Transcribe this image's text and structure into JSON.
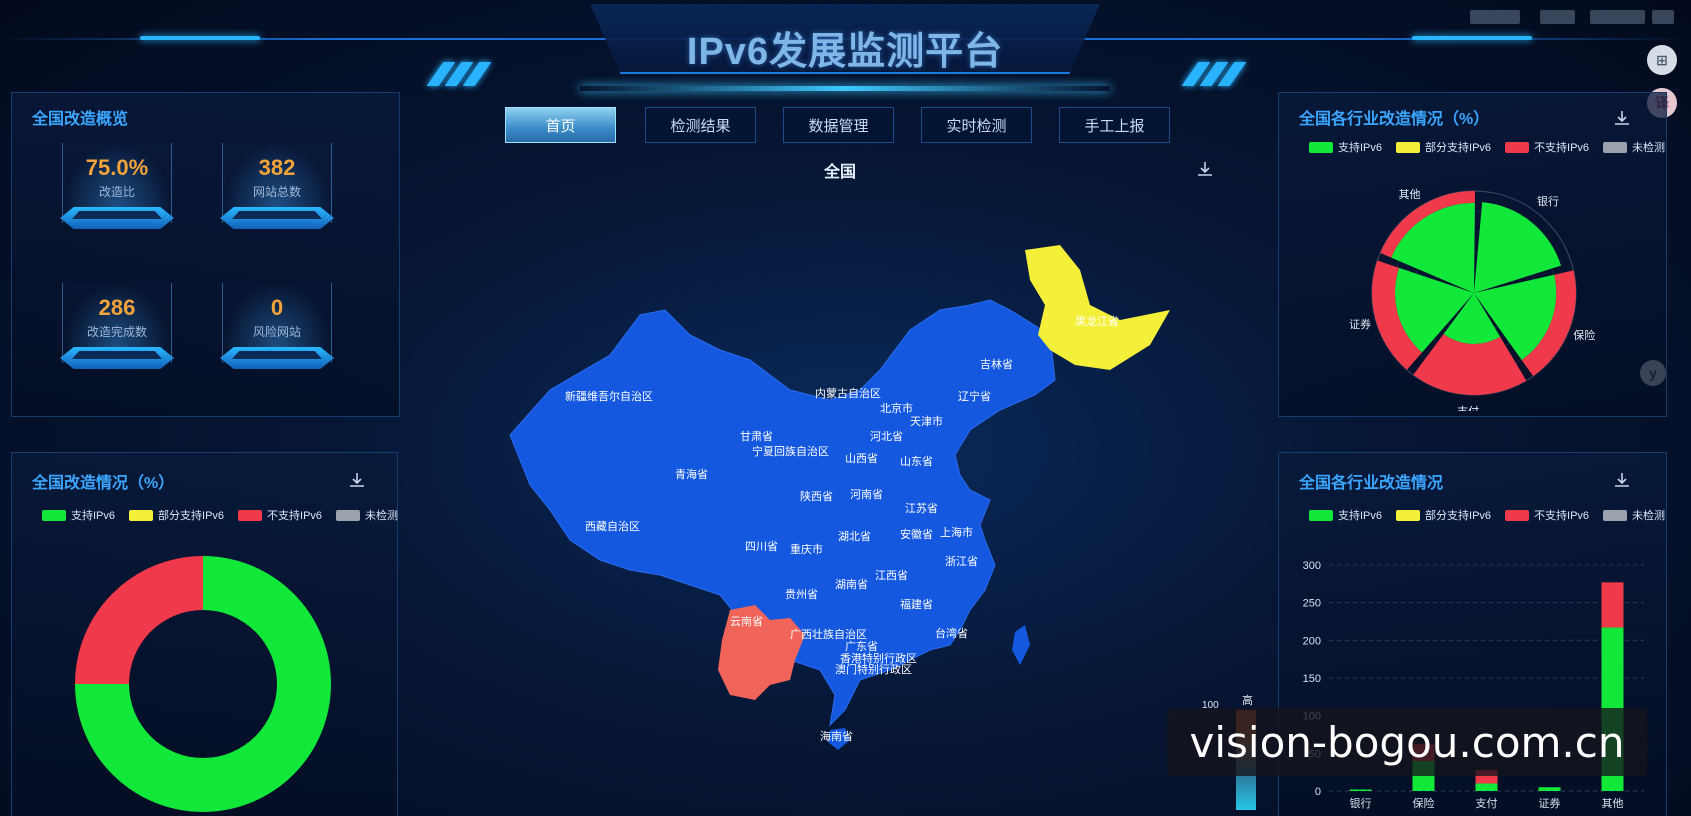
{
  "header": {
    "title": "IPv6发展监测平台"
  },
  "nav": {
    "items": [
      {
        "label": "首页",
        "active": true
      },
      {
        "label": "检测结果",
        "active": false
      },
      {
        "label": "数据管理",
        "active": false
      },
      {
        "label": "实时检测",
        "active": false
      },
      {
        "label": "手工上报",
        "active": false
      }
    ]
  },
  "overview": {
    "title": "全国改造概览",
    "cards": [
      {
        "value": "75.0%",
        "label": "改造比"
      },
      {
        "value": "382",
        "label": "网站总数"
      },
      {
        "value": "286",
        "label": "改造完成数"
      },
      {
        "value": "0",
        "label": "风险网站"
      }
    ]
  },
  "legend_labels": {
    "support": "支持IPv6",
    "partial": "部分支持IPv6",
    "unsupported": "不支持IPv6",
    "untested": "未检测"
  },
  "colors": {
    "support": "#11e83a",
    "partial": "#f4f03a",
    "unsupported": "#f0394a",
    "untested": "#9aa3ad",
    "accent": "#3ca6ff",
    "map_blue": "#1458e0"
  },
  "national": {
    "title": "全国改造情况（%）",
    "chart_data": {
      "type": "pie",
      "categories": [
        "支持IPv6",
        "部分支持IPv6",
        "不支持IPv6",
        "未检测"
      ],
      "values": [
        75,
        0,
        25,
        0
      ]
    }
  },
  "map": {
    "title": "全国",
    "scale_label_high": "高",
    "scale_value": "100",
    "provinces": [
      "新疆维吾尔自治区",
      "西藏自治区",
      "青海省",
      "甘肃省",
      "四川省",
      "云南省",
      "内蒙古自治区",
      "黑龙江省",
      "吉林省",
      "辽宁省",
      "北京市",
      "天津市",
      "河北省",
      "山西省",
      "山东省",
      "宁夏回族自治区",
      "陕西省",
      "河南省",
      "江苏省",
      "上海市",
      "安徽省",
      "湖北省",
      "重庆市",
      "浙江省",
      "江西省",
      "湖南省",
      "贵州省",
      "福建省",
      "广西壮族自治区",
      "广东省",
      "台湾省",
      "香港特别行政区",
      "澳门特别行政区",
      "海南省"
    ]
  },
  "industry_pct": {
    "title": "全国各行业改造情况（%）",
    "chart_data": {
      "type": "pie",
      "categories": [
        "银行",
        "保险",
        "支付\n机构",
        "证券",
        "其他"
      ],
      "support": [
        80,
        65,
        25,
        60,
        78
      ],
      "unsupported": [
        0,
        35,
        75,
        40,
        22
      ]
    }
  },
  "industry": {
    "title": "全国各行业改造情况",
    "chart_data": {
      "type": "bar",
      "categories": [
        "银行",
        "保险",
        "支付",
        "证券",
        "其他"
      ],
      "series": [
        {
          "name": "支持IPv6",
          "values": [
            2,
            40,
            10,
            5,
            217
          ]
        },
        {
          "name": "不支持IPv6",
          "values": [
            0,
            22,
            18,
            0,
            60
          ]
        }
      ],
      "ylim": [
        0,
        300
      ],
      "yticks": [
        0,
        50,
        100,
        150,
        200,
        250,
        300
      ]
    }
  },
  "watermark": "vision-bogou.com.cn"
}
